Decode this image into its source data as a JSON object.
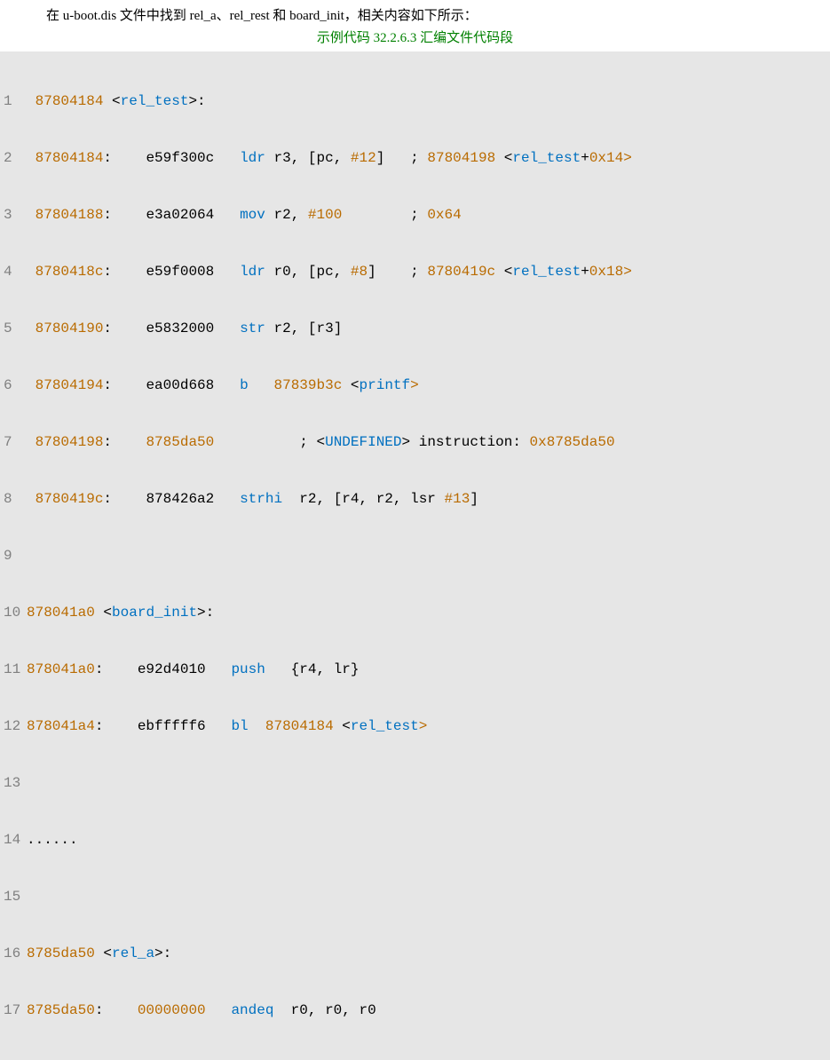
{
  "intro": "在 u-boot.dis 文件中找到 rel_a、rel_rest 和 board_init，相关内容如下所示：",
  "caption": "示例代码 32.2.6.3 汇编文件代码段",
  "lines": {
    "l1": {
      "ln": "1",
      "addr": "87804184",
      "sym": "rel_test"
    },
    "l2": {
      "ln": "2",
      "addr": "87804184",
      "hex": "e59f300c",
      "op": "ldr",
      "args": "r3, [pc, ",
      "imm": "#12",
      "args2": "]",
      "cmt_addr": "87804198",
      "cmt_sym": "rel_test",
      "cmt_off": "0x14"
    },
    "l3": {
      "ln": "3",
      "addr": "87804188",
      "hex": "e3a02064",
      "op": "mov",
      "args": "r2, ",
      "imm": "#100",
      "cmt": "0x64"
    },
    "l4": {
      "ln": "4",
      "addr": "8780418c",
      "hex": "e59f0008",
      "op": "ldr",
      "args": "r0, [pc, ",
      "imm": "#8",
      "args2": "]",
      "cmt_addr": "8780419c",
      "cmt_sym": "rel_test",
      "cmt_off": "0x18"
    },
    "l5": {
      "ln": "5",
      "addr": "87804190",
      "hex": "e5832000",
      "op": "str",
      "args": "r2, [r3]"
    },
    "l6": {
      "ln": "6",
      "addr": "87804194",
      "hex": "ea00d668",
      "op": "b",
      "tgt": "87839b3c",
      "sym": "printf"
    },
    "l7": {
      "ln": "7",
      "addr": "87804198",
      "hex": "8785da50",
      "undef": "UNDEFINED",
      "undef_txt": " instruction: ",
      "undef_val": "0x8785da50"
    },
    "l8": {
      "ln": "8",
      "addr": "8780419c",
      "hex": "878426a2",
      "op": "strhi",
      "args": "r2, [r4, r2, lsr ",
      "imm": "#13",
      "args2": "]"
    },
    "l9": {
      "ln": "9"
    },
    "l10": {
      "ln": "10",
      "addr": "878041a0",
      "sym": "board_init"
    },
    "l11": {
      "ln": "11",
      "addr": "878041a0",
      "hex": "e92d4010",
      "op": "push",
      "args": "{r4, lr}"
    },
    "l12": {
      "ln": "12",
      "addr": "878041a4",
      "hex": "ebfffff6",
      "op": "bl",
      "tgt": "87804184",
      "sym": "rel_test"
    },
    "l13": {
      "ln": "13"
    },
    "l14": {
      "ln": "14",
      "dots": "......"
    },
    "l15": {
      "ln": "15"
    },
    "l16": {
      "ln": "16",
      "addr": "8785da50",
      "sym": "rel_a"
    },
    "l17": {
      "ln": "17",
      "addr": "8785da50",
      "hex": "00000000",
      "op": "andeq",
      "args": "r0, r0, r0"
    }
  }
}
